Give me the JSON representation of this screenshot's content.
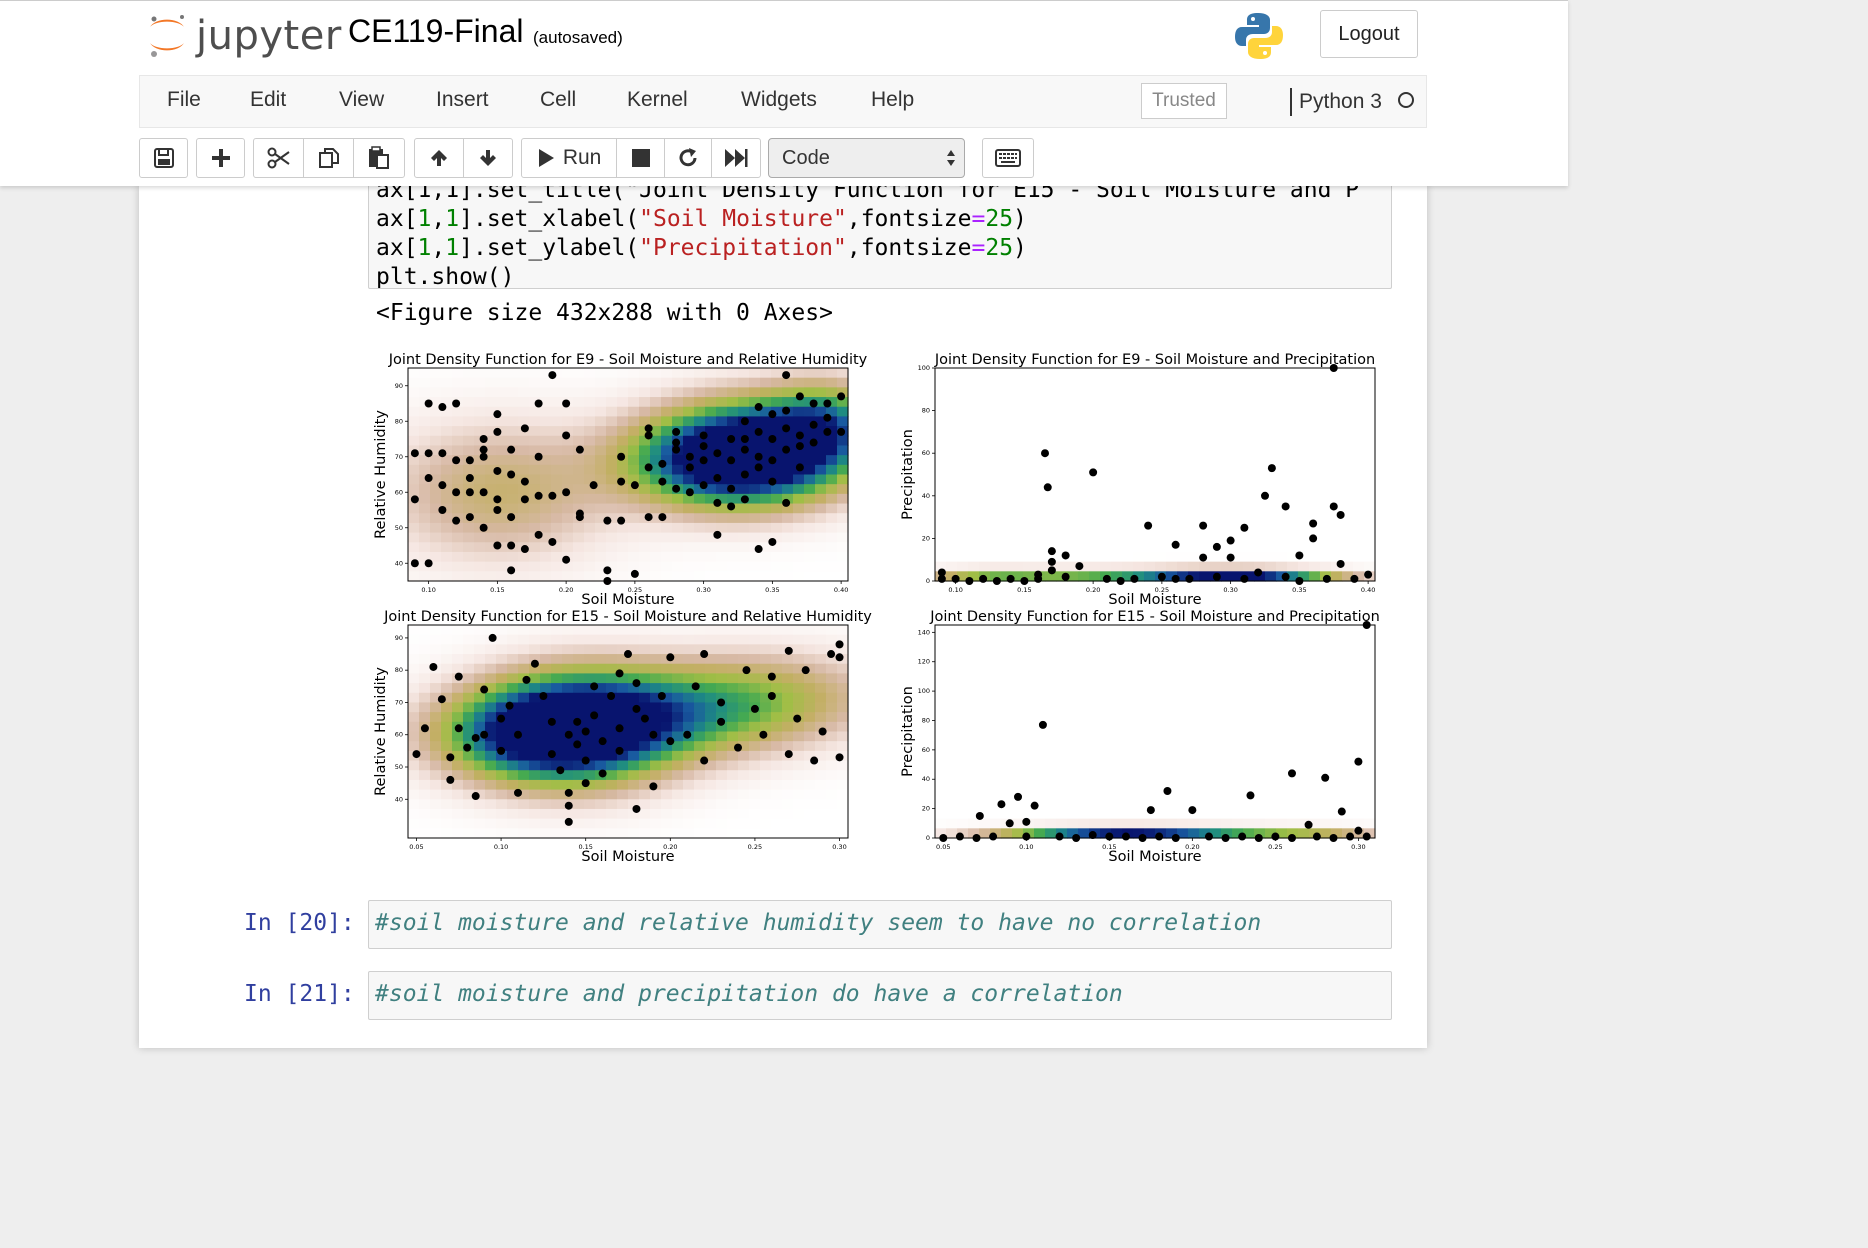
{
  "header": {
    "logo_text": "jupyter",
    "notebook_name": "CE119-Final",
    "autosave_status": "(autosaved)",
    "logout_label": "Logout"
  },
  "menubar": {
    "items": [
      "File",
      "Edit",
      "View",
      "Insert",
      "Cell",
      "Kernel",
      "Widgets",
      "Help"
    ],
    "trusted_label": "Trusted",
    "kernel_name": "Python 3"
  },
  "toolbar": {
    "run_label": "Run",
    "cell_type": "Code",
    "icons": [
      "save-icon",
      "plus-icon",
      "scissors-icon",
      "copy-icon",
      "paste-icon",
      "arrow-up-icon",
      "arrow-down-icon",
      "play-icon",
      "stop-icon",
      "restart-icon",
      "fast-forward-icon",
      "keyboard-icon"
    ]
  },
  "code_cell": {
    "line_0": "ax[1,1].set_title(\"Joint Density Function for E15 - Soil Moisture and P",
    "line_1_a": "ax[",
    "line_1_b": "1",
    "line_1_c": ",",
    "line_1_d": "1",
    "line_1_e": "].set_xlabel(",
    "line_1_f": "\"Soil Moisture\"",
    "line_1_g": ",fontsize",
    "line_1_h": "=",
    "line_1_i": "25",
    "line_1_j": ")",
    "line_2_a": "ax[",
    "line_2_b": "1",
    "line_2_c": ",",
    "line_2_d": "1",
    "line_2_e": "].set_ylabel(",
    "line_2_f": "\"Precipitation\"",
    "line_2_g": ",fontsize",
    "line_2_h": "=",
    "line_2_i": "25",
    "line_2_j": ")",
    "line_3": "plt.show()"
  },
  "output": {
    "figure_text": "<Figure size 432x288 with 0 Axes>"
  },
  "cells": [
    {
      "prompt": "In [20]:",
      "text": "#soil moisture and relative humidity seem to have no correlation"
    },
    {
      "prompt": "In [21]:",
      "text": "#soil moisture and precipitation do have a correlation"
    }
  ],
  "chart_data": [
    {
      "type": "scatter",
      "title": "Joint Density Function for E9 - Soil Moisture and Relative Humidity",
      "xlabel": "Soil Moisture",
      "ylabel": "Relative Humidity",
      "xlim": [
        0.085,
        0.405
      ],
      "ylim": [
        35,
        95
      ],
      "xticks": [
        0.1,
        0.15,
        0.2,
        0.25,
        0.3,
        0.35,
        0.4
      ],
      "yticks": [
        40,
        50,
        60,
        70,
        80,
        90
      ],
      "density_peaks": [
        [
          0.34,
          72,
          0.05,
          10,
          1.0
        ],
        [
          0.31,
          68,
          0.05,
          9,
          0.6
        ],
        [
          0.15,
          60,
          0.06,
          14,
          0.35
        ],
        [
          0.39,
          80,
          0.03,
          8,
          0.5
        ]
      ],
      "points": [
        [
          0.09,
          58
        ],
        [
          0.09,
          71
        ],
        [
          0.09,
          40
        ],
        [
          0.1,
          85
        ],
        [
          0.1,
          64
        ],
        [
          0.1,
          40
        ],
        [
          0.1,
          71
        ],
        [
          0.11,
          71
        ],
        [
          0.11,
          84
        ],
        [
          0.11,
          62
        ],
        [
          0.11,
          55
        ],
        [
          0.12,
          60
        ],
        [
          0.12,
          85
        ],
        [
          0.12,
          69
        ],
        [
          0.12,
          52
        ],
        [
          0.13,
          69
        ],
        [
          0.13,
          64
        ],
        [
          0.13,
          53
        ],
        [
          0.13,
          60
        ],
        [
          0.14,
          75
        ],
        [
          0.14,
          72
        ],
        [
          0.14,
          60
        ],
        [
          0.14,
          50
        ],
        [
          0.14,
          70
        ],
        [
          0.15,
          82
        ],
        [
          0.15,
          77
        ],
        [
          0.15,
          66
        ],
        [
          0.15,
          58
        ],
        [
          0.15,
          55
        ],
        [
          0.15,
          45
        ],
        [
          0.16,
          72
        ],
        [
          0.16,
          65
        ],
        [
          0.16,
          45
        ],
        [
          0.16,
          38
        ],
        [
          0.16,
          53
        ],
        [
          0.17,
          78
        ],
        [
          0.17,
          63
        ],
        [
          0.17,
          44
        ],
        [
          0.17,
          58
        ],
        [
          0.18,
          85
        ],
        [
          0.18,
          70
        ],
        [
          0.18,
          48
        ],
        [
          0.18,
          59
        ],
        [
          0.19,
          93
        ],
        [
          0.19,
          59
        ],
        [
          0.19,
          46
        ],
        [
          0.2,
          85
        ],
        [
          0.2,
          76
        ],
        [
          0.2,
          60
        ],
        [
          0.2,
          41
        ],
        [
          0.21,
          72
        ],
        [
          0.21,
          53
        ],
        [
          0.21,
          54
        ],
        [
          0.22,
          62
        ],
        [
          0.23,
          52
        ],
        [
          0.23,
          38
        ],
        [
          0.23,
          35
        ],
        [
          0.24,
          70
        ],
        [
          0.24,
          63
        ],
        [
          0.24,
          52
        ],
        [
          0.25,
          62
        ],
        [
          0.25,
          37
        ],
        [
          0.26,
          76
        ],
        [
          0.26,
          67
        ],
        [
          0.26,
          53
        ],
        [
          0.26,
          78
        ],
        [
          0.27,
          63
        ],
        [
          0.27,
          53
        ],
        [
          0.27,
          68
        ],
        [
          0.28,
          72
        ],
        [
          0.28,
          77
        ],
        [
          0.28,
          61
        ],
        [
          0.28,
          74
        ],
        [
          0.29,
          67
        ],
        [
          0.29,
          70
        ],
        [
          0.29,
          60
        ],
        [
          0.3,
          76
        ],
        [
          0.3,
          62
        ],
        [
          0.3,
          69
        ],
        [
          0.3,
          73
        ],
        [
          0.31,
          71
        ],
        [
          0.31,
          57
        ],
        [
          0.31,
          48
        ],
        [
          0.31,
          64
        ],
        [
          0.32,
          75
        ],
        [
          0.32,
          69
        ],
        [
          0.32,
          56
        ],
        [
          0.32,
          61
        ],
        [
          0.33,
          72
        ],
        [
          0.33,
          65
        ],
        [
          0.33,
          58
        ],
        [
          0.33,
          75
        ],
        [
          0.34,
          84
        ],
        [
          0.34,
          70
        ],
        [
          0.34,
          44
        ],
        [
          0.34,
          67
        ],
        [
          0.34,
          77
        ],
        [
          0.35,
          82
        ],
        [
          0.35,
          75
        ],
        [
          0.35,
          63
        ],
        [
          0.35,
          46
        ],
        [
          0.35,
          69
        ],
        [
          0.36,
          83
        ],
        [
          0.36,
          72
        ],
        [
          0.36,
          57
        ],
        [
          0.36,
          78
        ],
        [
          0.37,
          87
        ],
        [
          0.37,
          73
        ],
        [
          0.37,
          67
        ],
        [
          0.37,
          76
        ],
        [
          0.38,
          79
        ],
        [
          0.38,
          85
        ],
        [
          0.38,
          74
        ],
        [
          0.39,
          85
        ],
        [
          0.39,
          77
        ],
        [
          0.39,
          81
        ],
        [
          0.4,
          87
        ],
        [
          0.4,
          77
        ],
        [
          0.36,
          93
        ],
        [
          0.33,
          80
        ]
      ]
    },
    {
      "type": "scatter",
      "title": "Joint Density Function for E9 - Soil Moisture and Precipitation",
      "xlabel": "Soil Moisture",
      "ylabel": "Precipitation",
      "xlim": [
        0.085,
        0.405
      ],
      "ylim": [
        0,
        100
      ],
      "xticks": [
        0.1,
        0.15,
        0.2,
        0.25,
        0.3,
        0.35,
        0.4
      ],
      "yticks": [
        0,
        20,
        40,
        60,
        80,
        100
      ],
      "density_peaks": [
        [
          0.31,
          1,
          0.05,
          3,
          1.0
        ],
        [
          0.2,
          1,
          0.07,
          3,
          0.55
        ],
        [
          0.12,
          1,
          0.03,
          3,
          0.3
        ]
      ],
      "points": [
        [
          0.09,
          4
        ],
        [
          0.09,
          1
        ],
        [
          0.1,
          1
        ],
        [
          0.11,
          0
        ],
        [
          0.12,
          1
        ],
        [
          0.13,
          0
        ],
        [
          0.14,
          1
        ],
        [
          0.15,
          0
        ],
        [
          0.16,
          1
        ],
        [
          0.16,
          3
        ],
        [
          0.165,
          60
        ],
        [
          0.167,
          44
        ],
        [
          0.17,
          14
        ],
        [
          0.17,
          9
        ],
        [
          0.17,
          5
        ],
        [
          0.18,
          12
        ],
        [
          0.18,
          2
        ],
        [
          0.19,
          7
        ],
        [
          0.2,
          51
        ],
        [
          0.21,
          1
        ],
        [
          0.22,
          0
        ],
        [
          0.23,
          1
        ],
        [
          0.24,
          26
        ],
        [
          0.25,
          2
        ],
        [
          0.26,
          1
        ],
        [
          0.26,
          17
        ],
        [
          0.27,
          1
        ],
        [
          0.28,
          26
        ],
        [
          0.28,
          11
        ],
        [
          0.29,
          2
        ],
        [
          0.29,
          16
        ],
        [
          0.3,
          11
        ],
        [
          0.3,
          19
        ],
        [
          0.31,
          25
        ],
        [
          0.31,
          1
        ],
        [
          0.32,
          4
        ],
        [
          0.325,
          40
        ],
        [
          0.33,
          53
        ],
        [
          0.34,
          35
        ],
        [
          0.34,
          2
        ],
        [
          0.35,
          12
        ],
        [
          0.35,
          0
        ],
        [
          0.36,
          27
        ],
        [
          0.36,
          20
        ],
        [
          0.37,
          1
        ],
        [
          0.375,
          35
        ],
        [
          0.38,
          31
        ],
        [
          0.38,
          8
        ],
        [
          0.39,
          1
        ],
        [
          0.4,
          3
        ],
        [
          0.375,
          100
        ]
      ]
    },
    {
      "type": "scatter",
      "title": "Joint Density Function for E15 - Soil Moisture and Relative Humidity",
      "xlabel": "Soil Moisture",
      "ylabel": "Relative Humidity",
      "xlim": [
        0.045,
        0.305
      ],
      "ylim": [
        28,
        94
      ],
      "xticks": [
        0.05,
        0.1,
        0.15,
        0.2,
        0.25,
        0.3
      ],
      "yticks": [
        40,
        50,
        60,
        70,
        80,
        90
      ],
      "density_peaks": [
        [
          0.145,
          62,
          0.04,
          12,
          1.0
        ],
        [
          0.11,
          60,
          0.04,
          10,
          0.55
        ],
        [
          0.2,
          66,
          0.05,
          10,
          0.45
        ],
        [
          0.26,
          72,
          0.05,
          10,
          0.35
        ]
      ],
      "points": [
        [
          0.05,
          54
        ],
        [
          0.055,
          62
        ],
        [
          0.06,
          81
        ],
        [
          0.065,
          71
        ],
        [
          0.07,
          53
        ],
        [
          0.07,
          46
        ],
        [
          0.075,
          62
        ],
        [
          0.075,
          78
        ],
        [
          0.08,
          56
        ],
        [
          0.085,
          41
        ],
        [
          0.085,
          59
        ],
        [
          0.09,
          74
        ],
        [
          0.09,
          60
        ],
        [
          0.095,
          90
        ],
        [
          0.1,
          65
        ],
        [
          0.1,
          55
        ],
        [
          0.105,
          69
        ],
        [
          0.11,
          42
        ],
        [
          0.11,
          60
        ],
        [
          0.115,
          77
        ],
        [
          0.12,
          82
        ],
        [
          0.125,
          72
        ],
        [
          0.13,
          64
        ],
        [
          0.13,
          54
        ],
        [
          0.135,
          49
        ],
        [
          0.14,
          42
        ],
        [
          0.14,
          60
        ],
        [
          0.14,
          38
        ],
        [
          0.14,
          33
        ],
        [
          0.145,
          64
        ],
        [
          0.145,
          57
        ],
        [
          0.15,
          61
        ],
        [
          0.15,
          52
        ],
        [
          0.15,
          45
        ],
        [
          0.155,
          75
        ],
        [
          0.155,
          66
        ],
        [
          0.16,
          58
        ],
        [
          0.16,
          48
        ],
        [
          0.165,
          72
        ],
        [
          0.17,
          79
        ],
        [
          0.17,
          62
        ],
        [
          0.17,
          55
        ],
        [
          0.175,
          85
        ],
        [
          0.18,
          76
        ],
        [
          0.18,
          68
        ],
        [
          0.18,
          37
        ],
        [
          0.185,
          65
        ],
        [
          0.19,
          44
        ],
        [
          0.19,
          60
        ],
        [
          0.195,
          72
        ],
        [
          0.2,
          58
        ],
        [
          0.2,
          84
        ],
        [
          0.21,
          60
        ],
        [
          0.215,
          75
        ],
        [
          0.22,
          85
        ],
        [
          0.22,
          52
        ],
        [
          0.23,
          70
        ],
        [
          0.23,
          64
        ],
        [
          0.24,
          56
        ],
        [
          0.245,
          80
        ],
        [
          0.25,
          68
        ],
        [
          0.255,
          60
        ],
        [
          0.26,
          78
        ],
        [
          0.26,
          72
        ],
        [
          0.27,
          86
        ],
        [
          0.27,
          54
        ],
        [
          0.275,
          65
        ],
        [
          0.28,
          80
        ],
        [
          0.285,
          52
        ],
        [
          0.29,
          61
        ],
        [
          0.295,
          85
        ],
        [
          0.3,
          88
        ],
        [
          0.3,
          53
        ],
        [
          0.3,
          84
        ]
      ]
    },
    {
      "type": "scatter",
      "title": "Joint Density Function for E15 - Soil Moisture and Precipitation",
      "xlabel": "Soil Moisture",
      "ylabel": "Precipitation",
      "xlim": [
        0.045,
        0.31
      ],
      "ylim": [
        0,
        145
      ],
      "xticks": [
        0.05,
        0.1,
        0.15,
        0.2,
        0.25,
        0.3
      ],
      "yticks": [
        0,
        20,
        40,
        60,
        80,
        100,
        120,
        140
      ],
      "density_peaks": [
        [
          0.15,
          1,
          0.05,
          4,
          1.0
        ],
        [
          0.22,
          1,
          0.05,
          4,
          0.4
        ],
        [
          0.28,
          1,
          0.03,
          4,
          0.25
        ]
      ],
      "points": [
        [
          0.05,
          0
        ],
        [
          0.06,
          1
        ],
        [
          0.07,
          0
        ],
        [
          0.072,
          15
        ],
        [
          0.08,
          1
        ],
        [
          0.085,
          23
        ],
        [
          0.09,
          10
        ],
        [
          0.095,
          28
        ],
        [
          0.1,
          11
        ],
        [
          0.1,
          1
        ],
        [
          0.105,
          22
        ],
        [
          0.11,
          77
        ],
        [
          0.12,
          1
        ],
        [
          0.13,
          0
        ],
        [
          0.14,
          2
        ],
        [
          0.15,
          1
        ],
        [
          0.16,
          1
        ],
        [
          0.17,
          0
        ],
        [
          0.175,
          19
        ],
        [
          0.18,
          1
        ],
        [
          0.185,
          32
        ],
        [
          0.19,
          0
        ],
        [
          0.2,
          19
        ],
        [
          0.21,
          1
        ],
        [
          0.22,
          0
        ],
        [
          0.23,
          1
        ],
        [
          0.235,
          29
        ],
        [
          0.24,
          0
        ],
        [
          0.25,
          1
        ],
        [
          0.26,
          0
        ],
        [
          0.26,
          44
        ],
        [
          0.27,
          9
        ],
        [
          0.275,
          1
        ],
        [
          0.28,
          41
        ],
        [
          0.285,
          0
        ],
        [
          0.29,
          18
        ],
        [
          0.295,
          1
        ],
        [
          0.3,
          52
        ],
        [
          0.3,
          5
        ],
        [
          0.305,
          1
        ],
        [
          0.305,
          145
        ]
      ]
    }
  ]
}
